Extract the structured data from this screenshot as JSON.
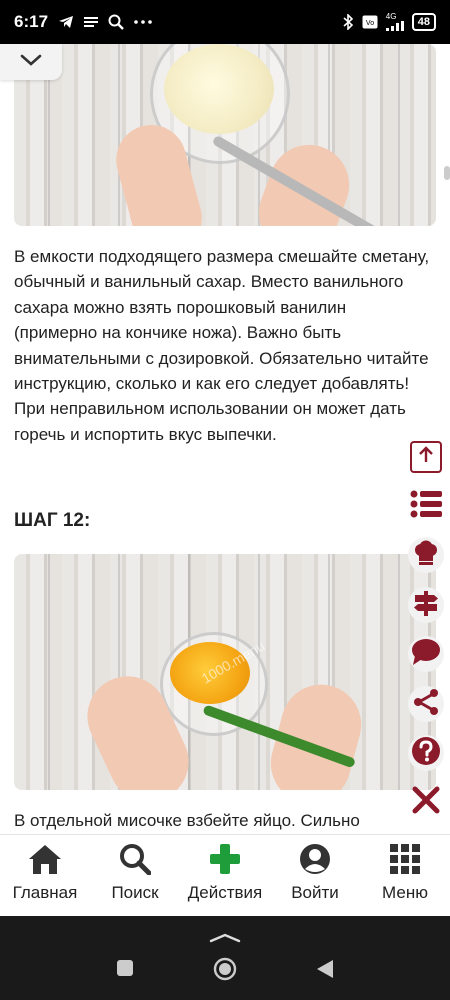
{
  "status_bar": {
    "time": "6:17",
    "battery": "48",
    "network": "4G",
    "icons": [
      "telegram-icon",
      "notes-icon",
      "search-icon",
      "more-icon",
      "bluetooth-icon",
      "volte-icon",
      "signal-icon",
      "battery-icon"
    ]
  },
  "article": {
    "step11_text": "В емкости подходящего размера смешайте сметану, обычный и ванильный сахар. Вместо ванильного сахара можно взять порошковый ванилин (примерно на кончике ножа). Важно быть внимательными с дозировкой. Обязательно читайте инструкцию, сколько и как его следует добавлять! При неправильном использовании он может дать горечь и испортить вкус выпечки.",
    "step12_heading": "ШАГ 12:",
    "step12_text": "В отдельной мисочке взбейте яйцо. Сильно",
    "watermark": "1000.menu"
  },
  "side_buttons": [
    "scroll-top-icon",
    "list-icon",
    "chef-hat-icon",
    "signpost-icon",
    "comment-icon",
    "share-icon",
    "help-icon",
    "close-icon"
  ],
  "accent_color": "#8b1a2b",
  "action_color": "#1f9d3a",
  "bottom_nav": {
    "home": "Главная",
    "search": "Поиск",
    "actions": "Действия",
    "login": "Войти",
    "menu": "Меню"
  }
}
